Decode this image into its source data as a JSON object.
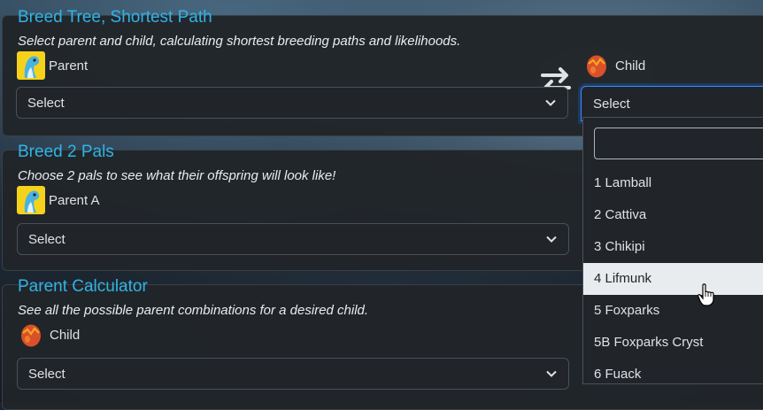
{
  "breed_tree": {
    "title": "Breed Tree, Shortest Path",
    "subtitle": "Select parent and child, calculating shortest breeding paths and likelihoods.",
    "parent_label": "Parent",
    "child_label": "Child",
    "parent_select": "Select",
    "child_select": "Select"
  },
  "breed_two": {
    "title": "Breed 2 Pals",
    "subtitle": "Choose 2 pals to see what their offspring will look like!",
    "parent_a_label": "Parent A",
    "parent_a_select": "Select"
  },
  "parent_calc": {
    "title": "Parent Calculator",
    "subtitle": "See all the possible parent combinations for a desired child.",
    "child_label": "Child",
    "child_select": "Select"
  },
  "dropdown": {
    "search_value": "",
    "options": [
      "1 Lamball",
      "2 Cattiva",
      "3 Chikipi",
      "4 Lifmunk",
      "5 Foxparks",
      "5B Foxparks Cryst",
      "6 Fuack"
    ],
    "highlighted": "4 Lifmunk"
  },
  "icons": {
    "pal_avatar": "pal-avatar-icon",
    "egg": "egg-icon",
    "swap": "swap-arrows-icon",
    "chevron": "chevron-down-icon",
    "cursor": "hand-pointer-icon"
  },
  "colors": {
    "accent_title": "#30b4e6",
    "panel_bg": "#212529",
    "focus_border": "#3d8bfd",
    "highlight_bg": "#e9ecef"
  }
}
